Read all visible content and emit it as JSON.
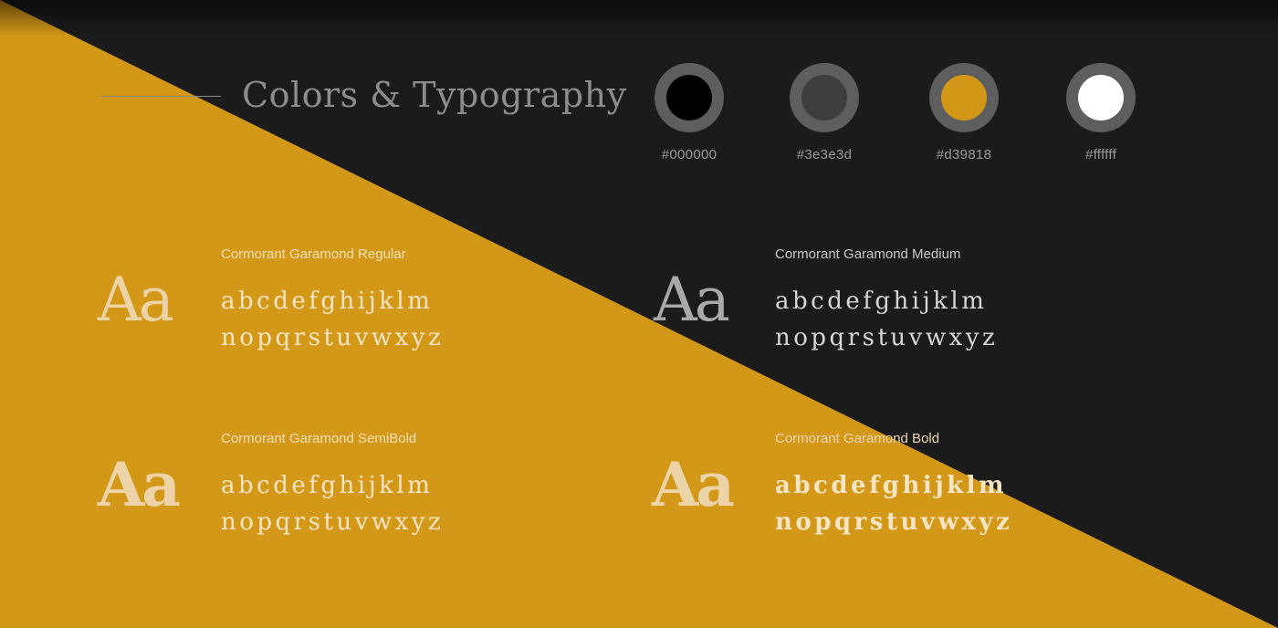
{
  "colors": {
    "background_dark": "#1b1b1b",
    "accent_band": "#d39818",
    "title_text": "#8d8d8d",
    "ring": "#5e5e5e"
  },
  "header": {
    "title": "Colors & Typography"
  },
  "palette": [
    {
      "hex": "#000000",
      "fill": "#000000"
    },
    {
      "hex": "#3e3e3d",
      "fill": "#3e3e3d"
    },
    {
      "hex": "#d39818",
      "fill": "#d39818"
    },
    {
      "hex": "#ffffff",
      "fill": "#ffffff"
    }
  ],
  "fonts": [
    {
      "name": "Cormorant Garamond Regular",
      "sample": "Aa",
      "line1": "abcdefghijklm",
      "line2": "nopqrstuvwxyz"
    },
    {
      "name": "Cormorant Garamond Medium",
      "sample": "Aa",
      "line1": "abcdefghijklm",
      "line2": "nopqrstuvwxyz"
    },
    {
      "name": "Cormorant Garamond SemiBold",
      "sample": "Aa",
      "line1": "abcdefghijklm",
      "line2": "nopqrstuvwxyz"
    },
    {
      "name": "Cormorant Garamond Bold",
      "sample": "Aa",
      "line1": "abcdefghijklm",
      "line2": "nopqrstuvwxyz"
    }
  ]
}
